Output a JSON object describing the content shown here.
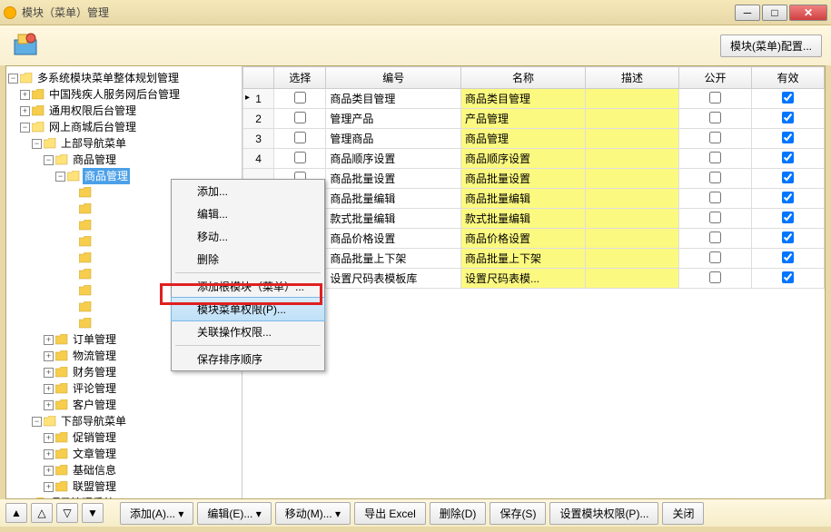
{
  "window": {
    "title": "模块（菜单）管理"
  },
  "toolbar": {
    "configBtn": "模块(菜单)配置..."
  },
  "tree": {
    "root": "多系统模块菜单整体规划管理",
    "n1": "中国残疾人服务网后台管理",
    "n2": "通用权限后台管理",
    "n3": "网上商城后台管理",
    "n3_1": "上部导航菜单",
    "n3_1_1": "商品管理",
    "n3_1_1_1": "商品管理",
    "n3_2": "订单管理",
    "n3_3": "物流管理",
    "n3_4": "财务管理",
    "n3_5": "评论管理",
    "n3_6": "客户管理",
    "n4": "下部导航菜单",
    "n4_1": "促销管理",
    "n4_2": "文章管理",
    "n4_3": "基础信息",
    "n4_4": "联盟管理",
    "n5": "项目管理系统"
  },
  "columns": {
    "sel": "选择",
    "code": "编号",
    "name": "名称",
    "desc": "描述",
    "open": "公开",
    "valid": "有效"
  },
  "rows": [
    {
      "num": "1",
      "arrow": true,
      "code": "商品类目管理",
      "name": "商品类目管理",
      "open": false,
      "valid": true
    },
    {
      "num": "2",
      "code": "管理产品",
      "name": "产品管理",
      "open": false,
      "valid": true
    },
    {
      "num": "3",
      "code": "管理商品",
      "name": "商品管理",
      "open": false,
      "valid": true
    },
    {
      "num": "4",
      "code": "商品顺序设置",
      "name": "商品顺序设置",
      "open": false,
      "valid": true
    },
    {
      "num": "",
      "code": "商品批量设置",
      "name": "商品批量设置",
      "open": false,
      "valid": true
    },
    {
      "num": "",
      "code": "商品批量编辑",
      "name": "商品批量编辑",
      "open": false,
      "valid": true
    },
    {
      "num": "",
      "code": "款式批量编辑",
      "name": "款式批量编辑",
      "open": false,
      "valid": true
    },
    {
      "num": "",
      "code": "商品价格设置",
      "name": "商品价格设置",
      "open": false,
      "valid": true
    },
    {
      "num": "",
      "code": "商品批量上下架",
      "name": "商品批量上下架",
      "open": false,
      "valid": true
    },
    {
      "num": "",
      "code": "设置尺码表模板库",
      "name": "设置尺码表模...",
      "open": false,
      "valid": true
    }
  ],
  "contextMenu": {
    "add": "添加...",
    "edit": "编辑...",
    "move": "移动...",
    "delete": "删除",
    "addRoot": "添加根模块（菜单）...",
    "modulePerm": "模块菜单权限(P)...",
    "relatedPerm": "关联操作权限...",
    "saveOrder": "保存排序顺序"
  },
  "bottom": {
    "add": "添加(A)...",
    "edit": "编辑(E)...",
    "move": "移动(M)...",
    "export": "导出 Excel",
    "delete": "删除(D)",
    "save": "保存(S)",
    "setPerm": "设置模块权限(P)...",
    "close": "关闭"
  }
}
